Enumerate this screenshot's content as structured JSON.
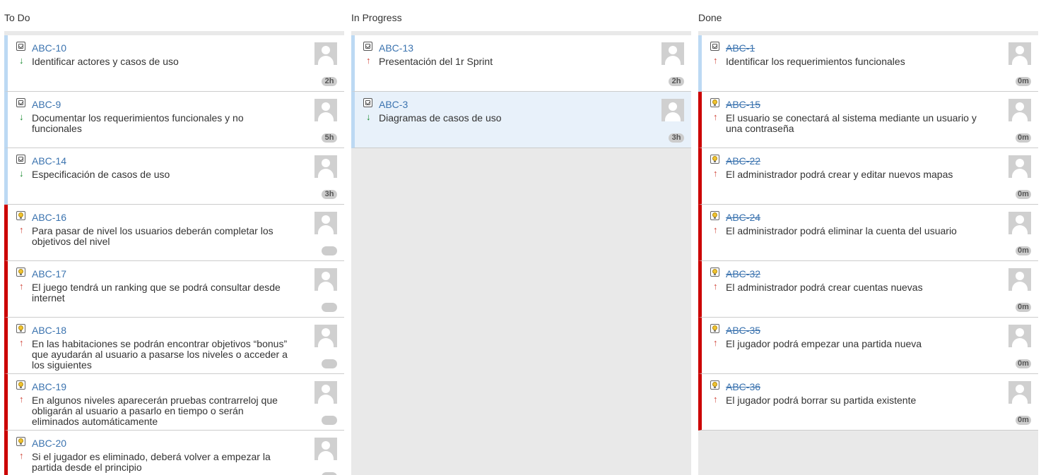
{
  "columns": [
    {
      "title": "To Do",
      "cards": [
        {
          "key": "ABC-10",
          "type": "task",
          "priority": "down",
          "summary": "Identificar actores y casos de uso",
          "estimate": "2h",
          "done": false,
          "selected": false
        },
        {
          "key": "ABC-9",
          "type": "task",
          "priority": "down",
          "summary": "Documentar los requerimientos funcionales y no funcionales",
          "estimate": "5h",
          "done": false,
          "selected": false
        },
        {
          "key": "ABC-14",
          "type": "task",
          "priority": "down",
          "summary": "Especificación de casos de uso",
          "estimate": "3h",
          "done": false,
          "selected": false
        },
        {
          "key": "ABC-16",
          "type": "story",
          "priority": "up",
          "summary": "Para pasar de nivel los usuarios deberán completar los objetivos del nivel",
          "estimate": "",
          "done": false,
          "selected": false
        },
        {
          "key": "ABC-17",
          "type": "story",
          "priority": "up",
          "summary": "El juego tendrá un ranking que se podrá consultar desde internet",
          "estimate": "",
          "done": false,
          "selected": false
        },
        {
          "key": "ABC-18",
          "type": "story",
          "priority": "up",
          "summary": "En las habitaciones se podrán encontrar objetivos “bonus” que ayudarán al usuario a pasarse los niveles o acceder a los siguientes",
          "estimate": "",
          "done": false,
          "selected": false
        },
        {
          "key": "ABC-19",
          "type": "story",
          "priority": "up",
          "summary": "En algunos niveles aparecerán pruebas contrarreloj que obligarán al usuario a pasarlo en tiempo o serán eliminados automáticamente",
          "estimate": "",
          "done": false,
          "selected": false
        },
        {
          "key": "ABC-20",
          "type": "story",
          "priority": "up",
          "summary": "Si el jugador es eliminado, deberá volver a empezar la partida desde el principio",
          "estimate": "",
          "done": false,
          "selected": false
        }
      ]
    },
    {
      "title": "In Progress",
      "cards": [
        {
          "key": "ABC-13",
          "type": "task",
          "priority": "up",
          "summary": "Presentación del 1r Sprint",
          "estimate": "2h",
          "done": false,
          "selected": false
        },
        {
          "key": "ABC-3",
          "type": "task",
          "priority": "down",
          "summary": "Diagramas de casos de uso",
          "estimate": "3h",
          "done": false,
          "selected": true
        }
      ]
    },
    {
      "title": "Done",
      "cards": [
        {
          "key": "ABC-1",
          "type": "task",
          "priority": "up",
          "summary": "Identificar los requerimientos funcionales",
          "estimate": "0m",
          "done": true,
          "selected": false
        },
        {
          "key": "ABC-15",
          "type": "story",
          "priority": "up",
          "summary": "El usuario se conectará al sistema mediante un usuario y una contraseña",
          "estimate": "0m",
          "done": true,
          "selected": false
        },
        {
          "key": "ABC-22",
          "type": "story",
          "priority": "up",
          "summary": "El administrador podrá crear y editar nuevos mapas",
          "estimate": "0m",
          "done": true,
          "selected": false
        },
        {
          "key": "ABC-24",
          "type": "story",
          "priority": "up",
          "summary": "El administrador podrá eliminar la cuenta del usuario",
          "estimate": "0m",
          "done": true,
          "selected": false
        },
        {
          "key": "ABC-32",
          "type": "story",
          "priority": "up",
          "summary": "El administrador podrá crear cuentas nuevas",
          "estimate": "0m",
          "done": true,
          "selected": false
        },
        {
          "key": "ABC-35",
          "type": "story",
          "priority": "up",
          "summary": "El jugador podrá empezar una partida nueva",
          "estimate": "0m",
          "done": true,
          "selected": false
        },
        {
          "key": "ABC-36",
          "type": "story",
          "priority": "up",
          "summary": "El jugador podrá borrar su partida existente",
          "estimate": "0m",
          "done": true,
          "selected": false
        }
      ]
    }
  ],
  "colors": {
    "link": "#3b73af",
    "story_border": "#cc0000",
    "task_border": "#bcd9f3",
    "priority_up": "#d04437",
    "priority_down": "#14892c",
    "column_bg": "#e9e9e9"
  }
}
